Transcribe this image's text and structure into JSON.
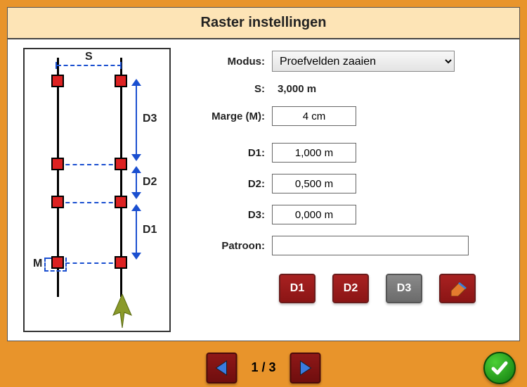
{
  "title": "Raster instellingen",
  "diagram_labels": {
    "S": "S",
    "M": "M",
    "D1": "D1",
    "D2": "D2",
    "D3": "D3"
  },
  "form": {
    "modus_label": "Modus:",
    "modus_value": "Proefvelden zaaien",
    "s_label": "S:",
    "s_value": "3,000 m",
    "marge_label": "Marge (M):",
    "marge_value": "4 cm",
    "d1_label": "D1:",
    "d1_value": "1,000 m",
    "d2_label": "D2:",
    "d2_value": "0,500 m",
    "d3_label": "D3:",
    "d3_value": "0,000 m",
    "patroon_label": "Patroon:",
    "patroon_value": ""
  },
  "buttons": {
    "d1": "D1",
    "d2": "D2",
    "d3": "D3"
  },
  "pager": {
    "text": "1 / 3"
  }
}
